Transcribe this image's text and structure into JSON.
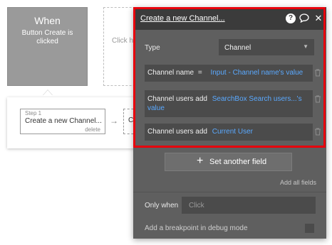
{
  "canvas": {
    "event": {
      "title": "When",
      "description": "Button Create is clicked"
    },
    "placeholder_text": "Click h",
    "step": {
      "number": "Step 1",
      "name": "Create a new Channel...",
      "delete": "delete"
    },
    "next_step_letter": "C",
    "arrow": "→"
  },
  "panel": {
    "title": "Create a new Channel...",
    "icons": {
      "help": "?",
      "comment": "comment-icon",
      "close": "✕"
    },
    "type_label": "Type",
    "type_value": "Channel",
    "fields": [
      {
        "label": "Channel name",
        "operator": "=",
        "value": "Input - Channel name's value"
      },
      {
        "label": "Channel users add",
        "value_line1": "SearchBox Search users...'s",
        "value_line2": "value"
      },
      {
        "label": "Channel users add",
        "value": "Current User"
      }
    ],
    "set_another_field": "Set another field",
    "add_all_fields": "Add all fields",
    "only_when_label": "Only when",
    "only_when_placeholder": "Click",
    "breakpoint_label": "Add a breakpoint in debug mode"
  },
  "colors": {
    "highlight": "#e8000c",
    "panel_bg": "#5f5f5f",
    "panel_header": "#3b3b3b",
    "link_blue": "#5aa9ff"
  }
}
